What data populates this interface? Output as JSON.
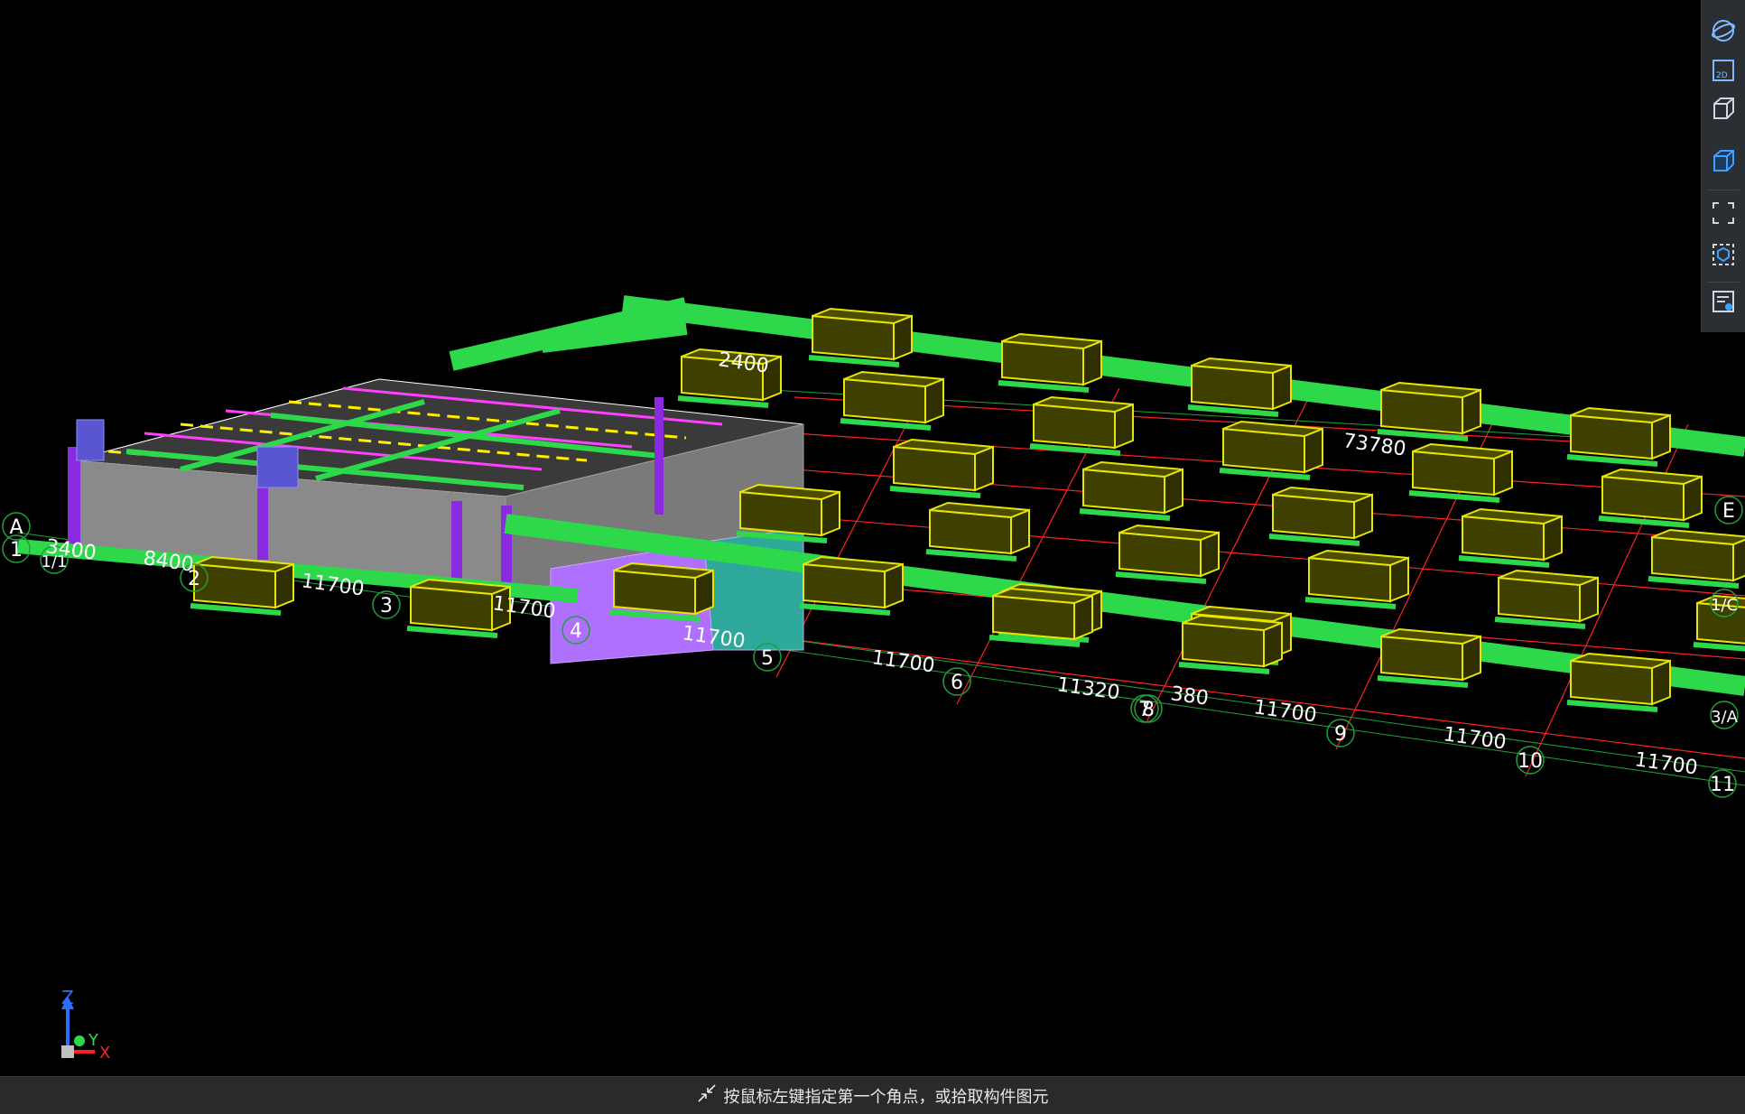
{
  "viewport": {
    "dim_labels": [
      "3400",
      "8400",
      "11700",
      "11700",
      "11700",
      "11700",
      "11320",
      "380",
      "11700",
      "11700",
      "11700",
      "73780",
      "2400"
    ],
    "axis_labels": [
      "1",
      "2",
      "3",
      "4",
      "5",
      "6",
      "7",
      "8",
      "9",
      "10",
      "11",
      "A",
      "1/1",
      "1/C",
      "3/A",
      "E"
    ],
    "gizmo": {
      "z": "Z",
      "y": "Y",
      "x": "X"
    }
  },
  "toolbar": {
    "icons": [
      "orbit-icon",
      "2d-view-icon",
      "3d-box-icon",
      "3d-box-blue-icon",
      "fit-view-icon",
      "selection-box-icon",
      "properties-list-icon"
    ],
    "label_2d": "2D"
  },
  "status": {
    "text": "按鼠标左键指定第一个角点，或拾取构件图元",
    "icon": "corner-select-icon"
  },
  "colors": {
    "beam": "#2dd84a",
    "footing": "#c8c800",
    "grid": "#ff2020",
    "wall": "#8a2be2",
    "slab": "#777777"
  }
}
